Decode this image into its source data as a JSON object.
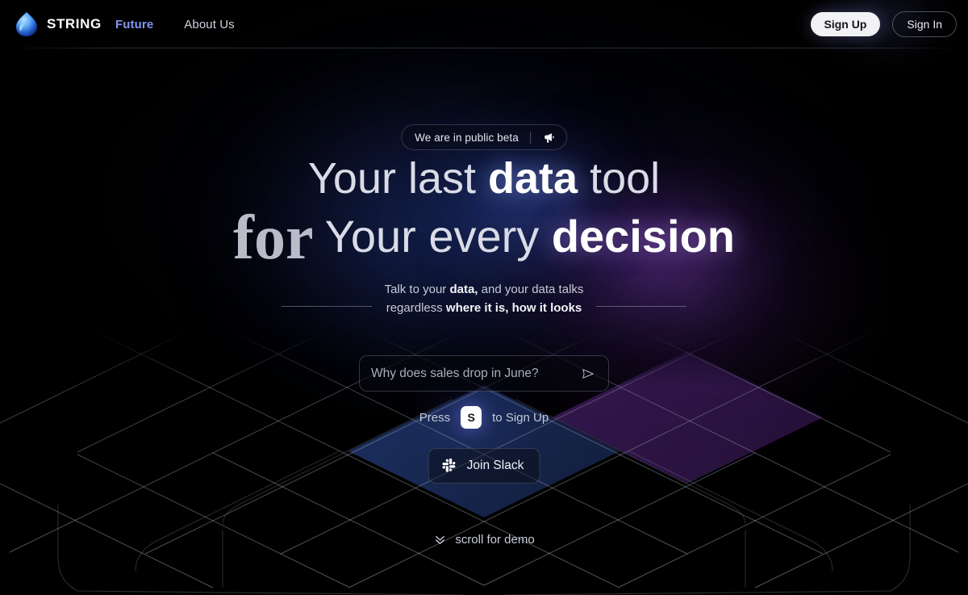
{
  "brand": {
    "name": "STRING",
    "logo_icon": "string-droplet-logo-icon"
  },
  "nav": {
    "items": [
      {
        "label": "Future",
        "active": true
      },
      {
        "label": "About Us",
        "active": false
      }
    ]
  },
  "auth": {
    "sign_up_label": "Sign Up",
    "sign_in_label": "Sign In"
  },
  "hero": {
    "badge": {
      "text": "We are in public beta",
      "icon": "megaphone-icon"
    },
    "headline": {
      "line1_part1": "Your last ",
      "line1_emphasis": "data",
      "line1_part2": " tool",
      "line2_serif": "for",
      "line2_part1": "Your every ",
      "line2_emphasis": "decision"
    },
    "subtitle": {
      "line1_part1": "Talk to your ",
      "line1_emphasis": "data,",
      "line1_part2": " and your data talks",
      "line2_part1": "regardless ",
      "line2_emphasis": "where it is, how it looks"
    },
    "prompt": {
      "placeholder": "Why does sales drop in June?",
      "value": "",
      "send_icon": "send-paper-plane-icon"
    },
    "press_hint": {
      "prefix": "Press",
      "key": "S",
      "suffix": "to Sign Up"
    },
    "slack": {
      "label": "Join Slack",
      "icon": "slack-icon"
    },
    "scroll": {
      "label": "scroll for demo",
      "icon": "chevron-double-down-icon"
    }
  },
  "colors": {
    "background": "#000000",
    "nav_active": "#8394ef",
    "accent_blue": "#2e4eb2",
    "accent_purple": "#7c3ab4",
    "iso_diamond_blue": "#1e3163",
    "iso_diamond_purple": "#3d1f5c",
    "signup_bg": "#f2f2f5",
    "text_primary": "#ffffff",
    "text_muted": "#c8cad6"
  }
}
